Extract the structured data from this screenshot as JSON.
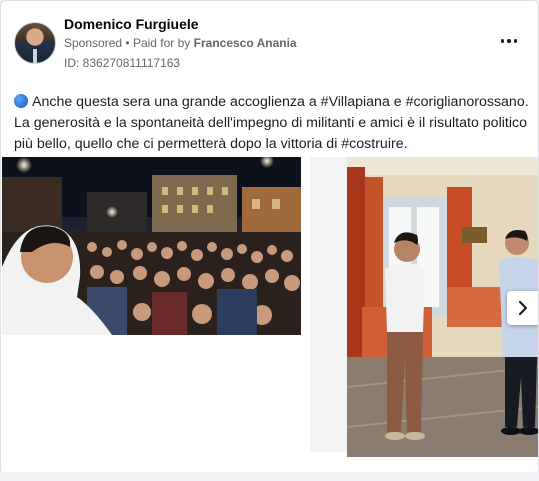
{
  "post": {
    "author": "Domenico Furgiuele",
    "sponsored_label": "Sponsored",
    "paid_for_prefix": "Paid for by",
    "paid_for_by": "Francesco Anania",
    "id_line": "ID: 836270811117163",
    "text_line1": "Anche questa sera una grande accoglienza a #Villapiana e #coriglianorossano.",
    "text_line2": "La generosità e la spontaneità dell'impegno di militanti e amici è il risultato politico",
    "text_line3": "più bello, quello che ci permetterà dopo la vittoria di #costruire."
  },
  "icons": {
    "more": "more-horizontal-icon",
    "next": "chevron-right-icon",
    "emoji": "blue-circle-emoji"
  },
  "colors": {
    "secondary_text": "#65676b",
    "emoji_blue": "#1c6fd1"
  }
}
